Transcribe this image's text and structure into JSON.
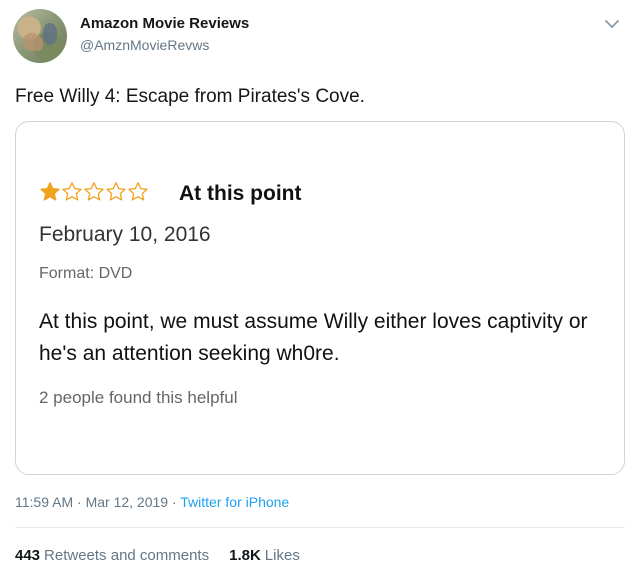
{
  "account": {
    "display_name": "Amazon Movie Reviews",
    "handle": "@AmznMovieRevws"
  },
  "tweet": {
    "text": "Free Willy 4: Escape from Pirates's Cove."
  },
  "review_card": {
    "rating": 1,
    "rating_max": 5,
    "star_color": "#f0a31c",
    "title": "At this point",
    "date": "February 10, 2016",
    "format": "Format: DVD",
    "body": "At this point, we must assume Willy either loves captivity or he's an attention seeking wh0re.",
    "helpful": "2 people found this helpful"
  },
  "meta": {
    "time": "11:59 AM",
    "separator": "·",
    "date": "Mar 12, 2019",
    "source": "Twitter for iPhone"
  },
  "stats": {
    "retweets_count": "443",
    "retweets_label": "Retweets and comments",
    "likes_count": "1.8K",
    "likes_label": "Likes"
  },
  "colors": {
    "link": "#1da1f2",
    "secondary_text": "#657786",
    "border": "#ccd6dd"
  },
  "icons": {
    "caret": "chevron-down-icon",
    "star_filled": "star-filled-icon",
    "star_empty": "star-empty-icon"
  }
}
